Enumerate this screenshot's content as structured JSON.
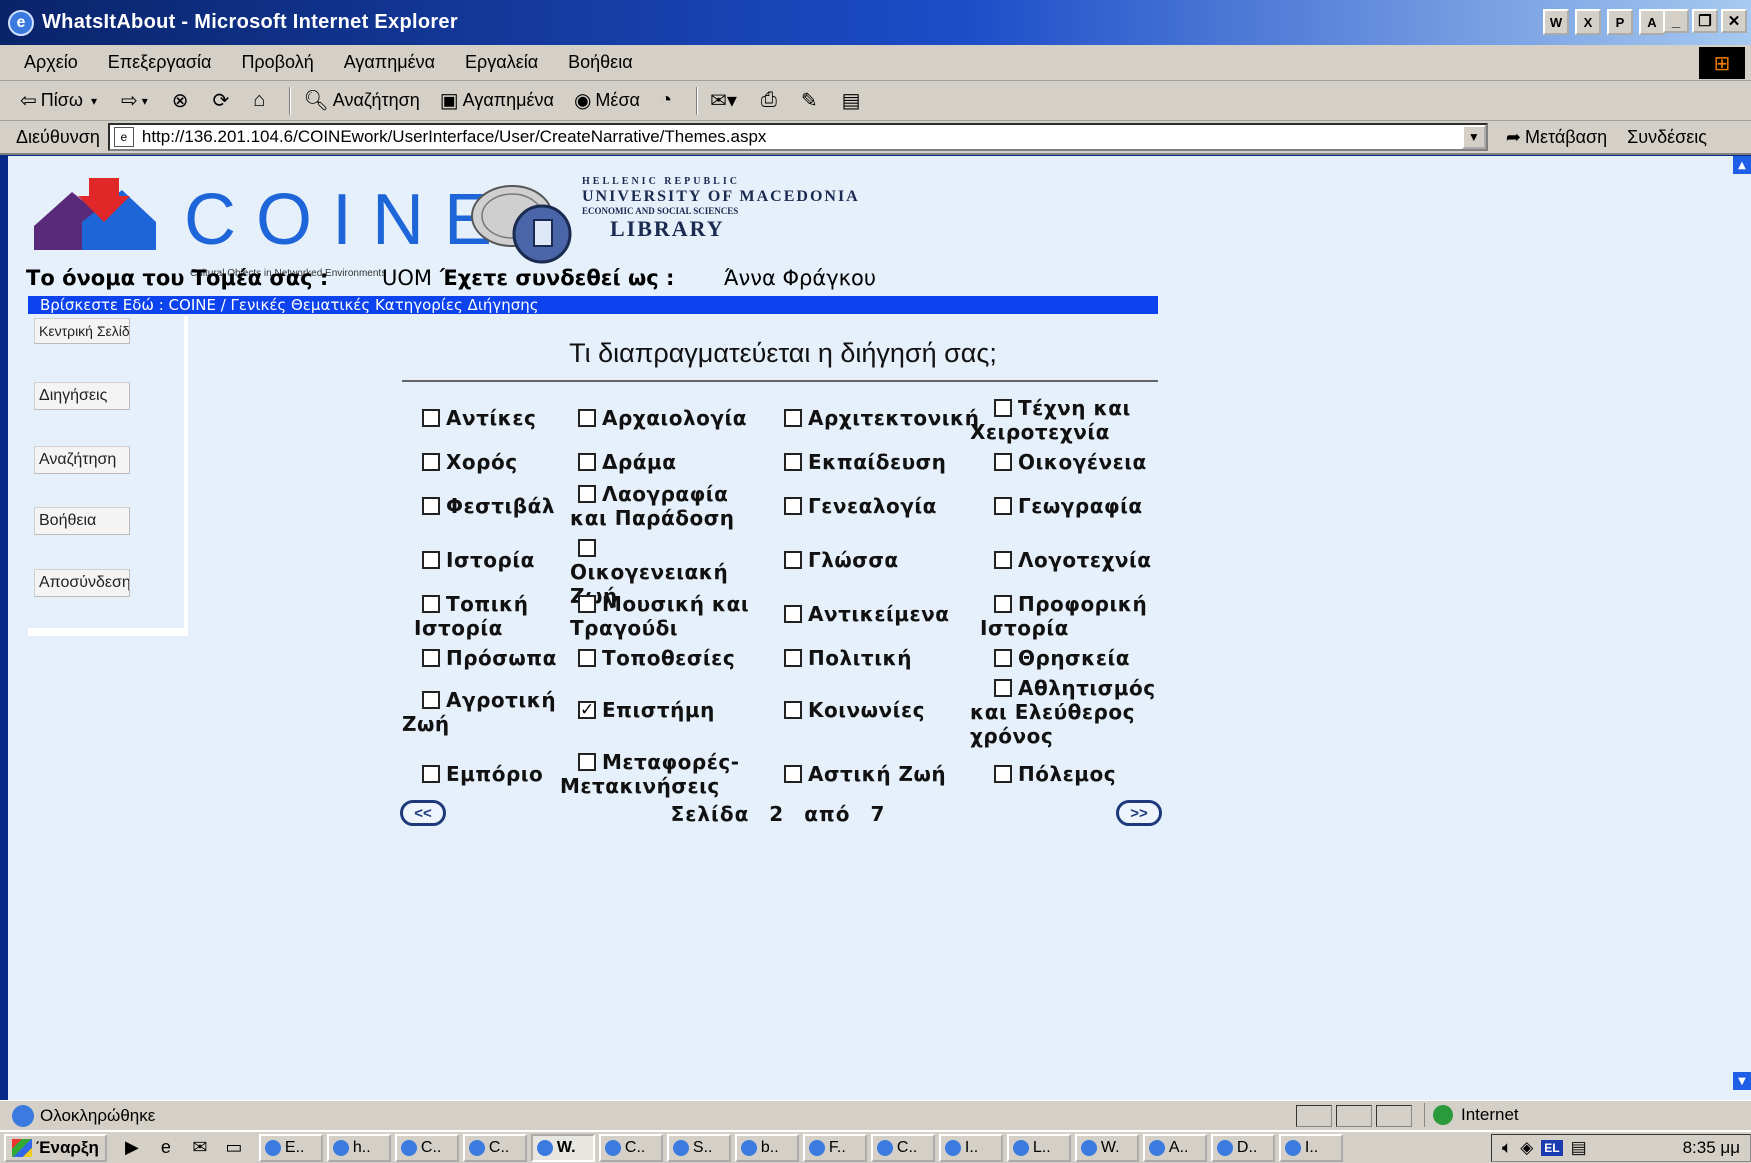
{
  "window": {
    "title": "WhatsItAbout - Microsoft Internet Explorer",
    "tray_app_icons": [
      "W",
      "X",
      "P",
      "A"
    ]
  },
  "menu": [
    "Αρχείο",
    "Επεξεργασία",
    "Προβολή",
    "Αγαπημένα",
    "Εργαλεία",
    "Βοήθεια"
  ],
  "toolbar": {
    "back": "Πίσω",
    "search": "Αναζήτηση",
    "favorites": "Αγαπημένα",
    "media": "Μέσα"
  },
  "address": {
    "label": "Διεύθυνση",
    "url": "http://136.201.104.6/COINEwork/UserInterface/User/CreateNarrative/Themes.aspx",
    "go": "Μετάβαση",
    "links": "Συνδέσεις"
  },
  "logos": {
    "coine_word": "COINE",
    "coine_tagline": "Cultural Objects in Networked Environments",
    "uom_line1": "HELLENIC REPUBLIC",
    "uom_line2": "UNIVERSITY OF MACEDONIA",
    "uom_line3": "ECONOMIC AND SOCIAL SCIENCES",
    "uom_line4": "LIBRARY"
  },
  "user_info": {
    "sector_label": "Το όνομα του Τομέα σας :",
    "sector_value": "UOM",
    "logged_label": "Έχετε συνδεθεί ως :",
    "logged_value": "Άννα Φράγκου"
  },
  "breadcrumb": "Βρίσκεστε Εδώ : COINE / Γενικές Θεματικές Κατηγορίες Διήγησης",
  "nav": {
    "home": "Κεντρική Σελίδα",
    "narratives": "Διηγήσεις",
    "search": "Αναζήτηση",
    "help": "Βοήθεια",
    "logout": "Αποσύνδεση"
  },
  "main": {
    "title": "Τι διαπραγματεύεται η διήγησή σας;",
    "themes": [
      {
        "label": "Αντίκες",
        "checked": false
      },
      {
        "label": "Αρχαιολογία",
        "checked": false
      },
      {
        "label": "Αρχιτεκτονική",
        "checked": false
      },
      {
        "label": "Τέχνη και Χειροτεχνία",
        "checked": false
      },
      {
        "label": "Χορός",
        "checked": false
      },
      {
        "label": "Δράμα",
        "checked": false
      },
      {
        "label": "Εκπαίδευση",
        "checked": false
      },
      {
        "label": "Οικογένεια",
        "checked": false
      },
      {
        "label": "Φεστιβάλ",
        "checked": false
      },
      {
        "label": "Λαογραφία και Παράδοση",
        "checked": false
      },
      {
        "label": "Γενεαλογία",
        "checked": false
      },
      {
        "label": "Γεωγραφία",
        "checked": false
      },
      {
        "label": "Ιστορία",
        "checked": false
      },
      {
        "label": "Οικογενειακή Ζωή",
        "checked": false
      },
      {
        "label": "Γλώσσα",
        "checked": false
      },
      {
        "label": "Λογοτεχνία",
        "checked": false
      },
      {
        "label": "Τοπική Ιστορία",
        "checked": false
      },
      {
        "label": "Μουσική και Τραγούδι",
        "checked": false
      },
      {
        "label": "Αντικείμενα",
        "checked": false
      },
      {
        "label": "Προφορική Ιστορία",
        "checked": false
      },
      {
        "label": "Πρόσωπα",
        "checked": false
      },
      {
        "label": "Τοποθεσίες",
        "checked": false
      },
      {
        "label": "Πολιτική",
        "checked": false
      },
      {
        "label": "Θρησκεία",
        "checked": false
      },
      {
        "label": "Αγροτική Ζωή",
        "checked": false
      },
      {
        "label": "Επιστήμη",
        "checked": true
      },
      {
        "label": "Κοινωνίες",
        "checked": false
      },
      {
        "label": "Αθλητισμός και Ελεύθερος χρόνος",
        "checked": false
      },
      {
        "label": "Εμπόριο",
        "checked": false
      },
      {
        "label": "Μεταφορές-Μετακινήσεις",
        "checked": false
      },
      {
        "label": "Αστική Ζωή",
        "checked": false
      },
      {
        "label": "Πόλεμος",
        "checked": false
      }
    ],
    "pager": {
      "prev": "<<",
      "next": ">>",
      "page_word": "Σελίδα",
      "current": "2",
      "of_word": "από",
      "total": "7"
    }
  },
  "status": {
    "text": "Ολοκληρώθηκε",
    "zone": "Internet"
  },
  "taskbar": {
    "start": "Έναρξη",
    "tasks": [
      "E..",
      "h..",
      "C..",
      "C..",
      "W.",
      "C..",
      "S..",
      "b..",
      "F..",
      "C..",
      "I..",
      "L..",
      "W.",
      "A..",
      "D..",
      "I.."
    ],
    "active_task": 4,
    "lang": "EL",
    "clock": "8:35 μμ"
  }
}
